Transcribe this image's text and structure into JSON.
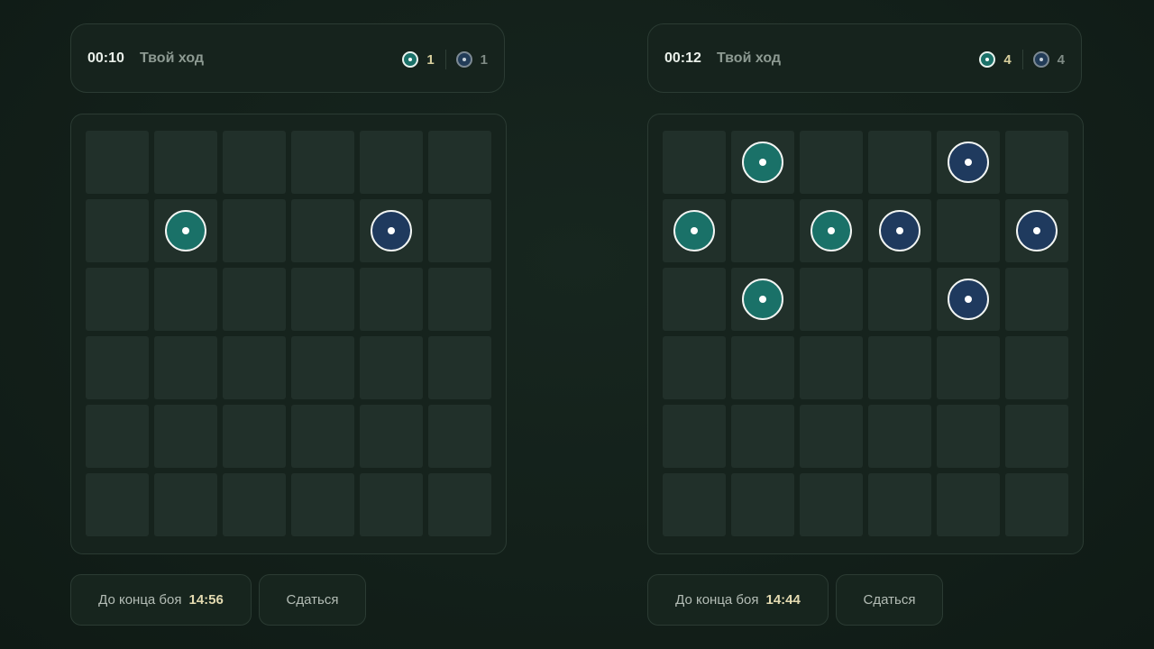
{
  "colors": {
    "teal_disc": "#1a7168",
    "navy_disc": "#1f3a5e",
    "cell": "#21302a",
    "background": "#13201a"
  },
  "panels": [
    {
      "timer": "00:10",
      "turn_label": "Твой ход",
      "score_me": "1",
      "score_opp": "1",
      "battle_end_label": "До конца боя",
      "battle_end_time": "14:56",
      "surrender_label": "Сдаться",
      "board": [
        [
          null,
          null,
          null,
          null,
          null,
          null
        ],
        [
          null,
          "teal",
          null,
          null,
          "navy",
          null
        ],
        [
          null,
          null,
          null,
          null,
          null,
          null
        ],
        [
          null,
          null,
          null,
          null,
          null,
          null
        ],
        [
          null,
          null,
          null,
          null,
          null,
          null
        ],
        [
          null,
          null,
          null,
          null,
          null,
          null
        ]
      ]
    },
    {
      "timer": "00:12",
      "turn_label": "Твой ход",
      "score_me": "4",
      "score_opp": "4",
      "battle_end_label": "До конца боя",
      "battle_end_time": "14:44",
      "surrender_label": "Сдаться",
      "board": [
        [
          null,
          "teal",
          null,
          null,
          "navy",
          null
        ],
        [
          "teal",
          null,
          "teal",
          "navy",
          null,
          "navy"
        ],
        [
          null,
          "teal",
          null,
          null,
          "navy",
          null
        ],
        [
          null,
          null,
          null,
          null,
          null,
          null
        ],
        [
          null,
          null,
          null,
          null,
          null,
          null
        ],
        [
          null,
          null,
          null,
          null,
          null,
          null
        ]
      ]
    }
  ]
}
